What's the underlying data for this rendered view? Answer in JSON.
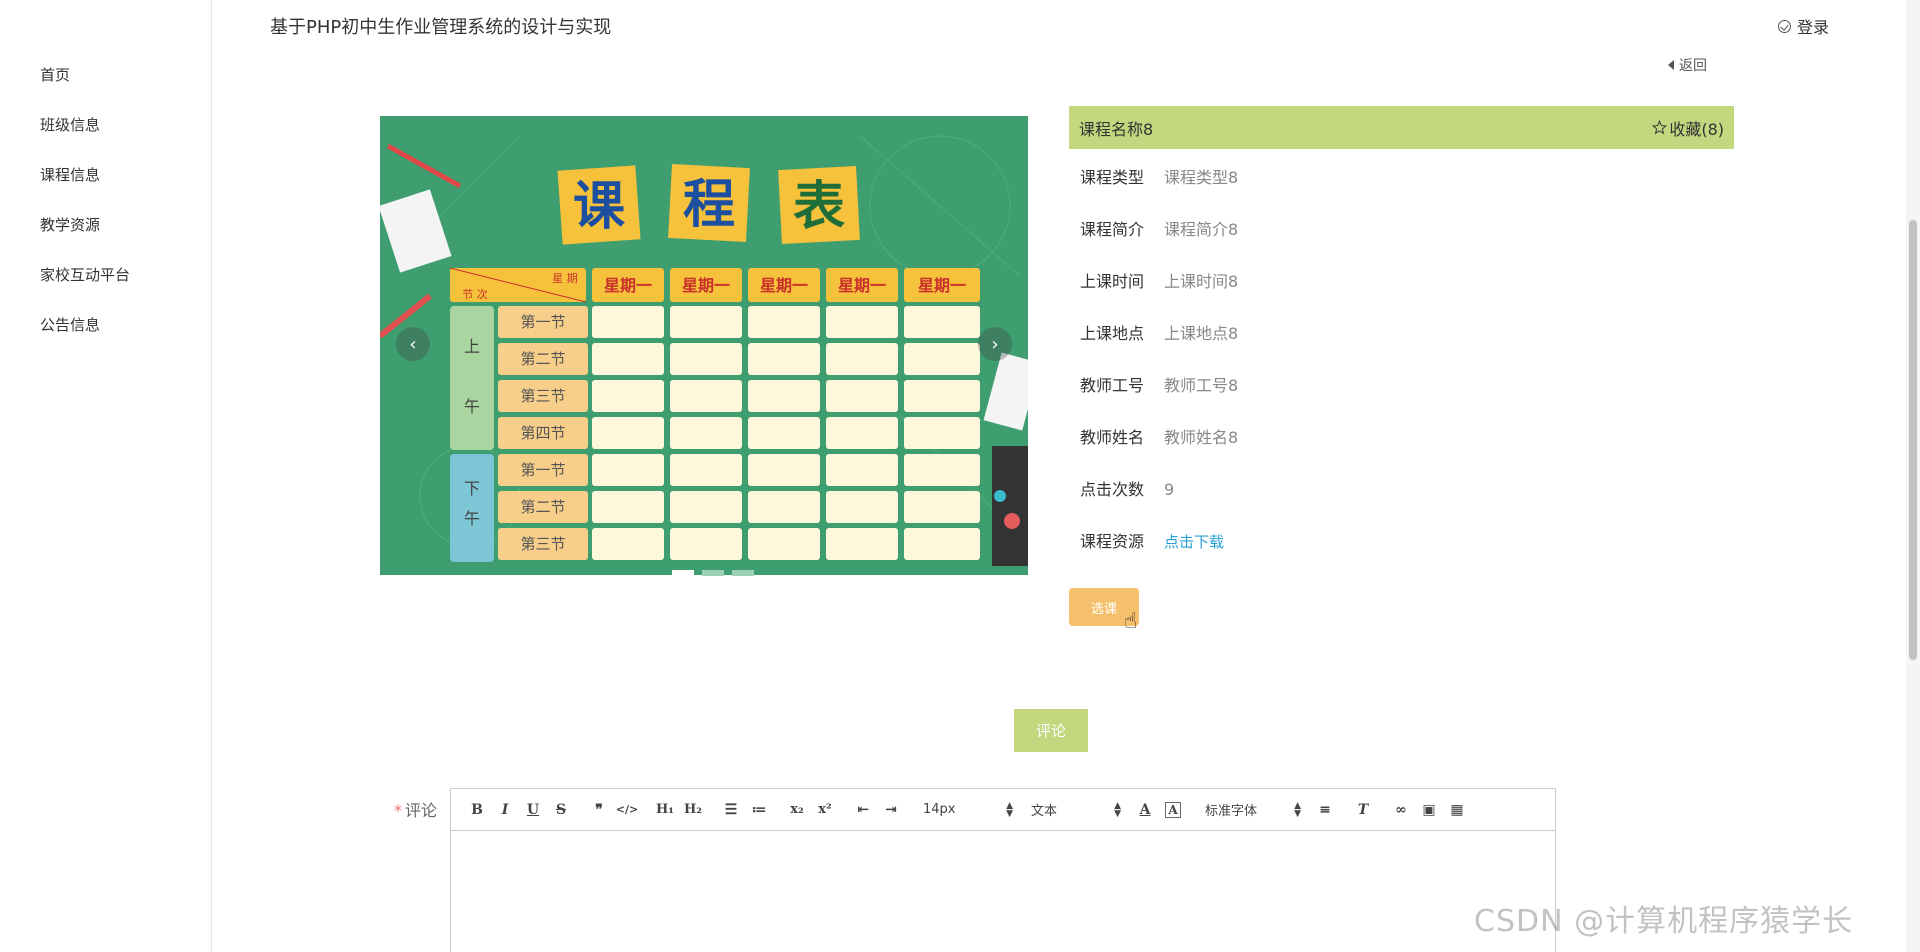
{
  "site": {
    "title": "基于PHP初中生作业管理系统的设计与实现",
    "login": "登录",
    "back": "返回"
  },
  "sidebar": {
    "items": [
      {
        "label": "首页"
      },
      {
        "label": "班级信息"
      },
      {
        "label": "课程信息"
      },
      {
        "label": "教学资源"
      },
      {
        "label": "家校互动平台"
      },
      {
        "label": "公告信息"
      }
    ]
  },
  "carousel": {
    "prev": "‹",
    "next": "›",
    "image": {
      "title_chars": [
        "课",
        "程",
        "表"
      ],
      "header_corner_top": "星 期",
      "header_corner_bottom": "节 次",
      "day_headers": [
        "星期一",
        "星期一",
        "星期一",
        "星期一",
        "星期一"
      ],
      "morning_label": [
        "上",
        "午"
      ],
      "afternoon_label": [
        "下",
        "午"
      ],
      "morning_periods": [
        "第一节",
        "第二节",
        "第三节",
        "第四节"
      ],
      "afternoon_periods": [
        "第一节",
        "第二节",
        "第三节"
      ]
    },
    "dots": 3,
    "active_dot": 0
  },
  "course": {
    "name": "课程名称8",
    "favorite": "收藏(8)",
    "fields": [
      {
        "label": "课程类型",
        "value": "课程类型8"
      },
      {
        "label": "课程简介",
        "value": "课程简介8"
      },
      {
        "label": "上课时间",
        "value": "上课时间8"
      },
      {
        "label": "上课地点",
        "value": "上课地点8"
      },
      {
        "label": "教师工号",
        "value": "教师工号8"
      },
      {
        "label": "教师姓名",
        "value": "教师姓名8"
      },
      {
        "label": "点击次数",
        "value": "9"
      }
    ],
    "resource_label": "课程资源",
    "resource_link": "点击下载",
    "select_button": "选课"
  },
  "comment": {
    "button": "评论",
    "required_mark": "*",
    "label": "评论",
    "toolbar": {
      "font_size": "14px",
      "header": "文本",
      "font_family": "标准字体"
    }
  },
  "watermark": "CSDN @计算机程序猿学长",
  "colors": {
    "accent": "#c3d77f",
    "select_button": "#f5c06b",
    "link": "#2a9fd6"
  }
}
